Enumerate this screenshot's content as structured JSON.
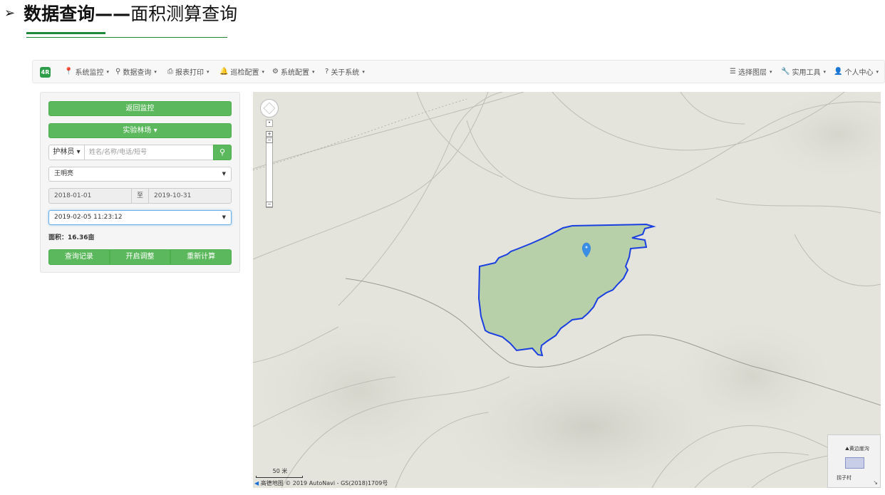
{
  "slide": {
    "arrow": "➢",
    "title_bold": "数据查询——",
    "title_rest": "面积测算查询"
  },
  "navbar": {
    "logo": "4R",
    "left_items": [
      {
        "icon": "map-marker-icon",
        "glyph": "📍",
        "label": "系统监控"
      },
      {
        "icon": "search-icon",
        "glyph": "⚲",
        "label": "数据查询"
      },
      {
        "icon": "print-icon",
        "glyph": "⎙",
        "label": "报表打印"
      },
      {
        "icon": "bell-icon",
        "glyph": "🔔",
        "label": "巡检配置"
      },
      {
        "icon": "gear-icon",
        "glyph": "⚙",
        "label": "系统配置"
      },
      {
        "icon": "question-icon",
        "glyph": "?",
        "label": "关于系统"
      }
    ],
    "right_items": [
      {
        "icon": "list-icon",
        "glyph": "☰",
        "label": "选择图层"
      },
      {
        "icon": "wrench-icon",
        "glyph": "🔧",
        "label": "实用工具"
      },
      {
        "icon": "user-icon",
        "glyph": "👤",
        "label": "个人中心"
      }
    ],
    "caret": "▾"
  },
  "panel": {
    "back_button": "返回监控",
    "forest_button": "实验林场 ▾",
    "ranger_dropdown": "护林员 ▾",
    "search_placeholder": "姓名/名称/电话/短号",
    "person_select": "王明亮",
    "date_from": "2018-01-01",
    "date_to_sep": "至",
    "date_to": "2019-10-31",
    "record_select": "2019-02-05 11:23:12",
    "area_label": "面积：",
    "area_value": "16.36亩",
    "actions": [
      "查询记录",
      "开启调整",
      "重新计算"
    ]
  },
  "map": {
    "scale_label": "50 米",
    "attribution": "高德地图 © 2019 AutoNavi - GS(2018)1709号",
    "overview_label1": "黄边崖沟",
    "overview_label2": "拐子村",
    "polygon_fill": "#a9c99a",
    "polygon_stroke": "#1a3fe0",
    "marker_color": "#3b8ee6"
  }
}
